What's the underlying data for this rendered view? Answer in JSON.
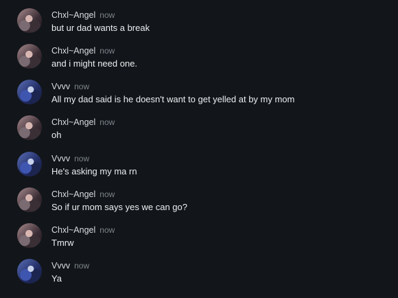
{
  "messages": [
    {
      "author": "Chxl~Angel",
      "time": "now",
      "text": "but ur dad wants a break",
      "avatar_icon": "angel-avatar"
    },
    {
      "author": "Chxl~Angel",
      "time": "now",
      "text": "and i might need one.",
      "avatar_icon": "angel-avatar"
    },
    {
      "author": "Vvvv",
      "time": "now",
      "text": "All my dad said is he doesn't want to get yelled at by my mom",
      "avatar_icon": "vvvv-avatar"
    },
    {
      "author": "Chxl~Angel",
      "time": "now",
      "text": "oh",
      "avatar_icon": "angel-avatar"
    },
    {
      "author": "Vvvv",
      "time": "now",
      "text": "He's asking my ma rn",
      "avatar_icon": "vvvv-avatar"
    },
    {
      "author": "Chxl~Angel",
      "time": "now",
      "text": "So if ur mom says yes we can go?",
      "avatar_icon": "angel-avatar"
    },
    {
      "author": "Chxl~Angel",
      "time": "now",
      "text": "Tmrw",
      "avatar_icon": "angel-avatar"
    },
    {
      "author": "Vvvv",
      "time": "now",
      "text": "Ya",
      "avatar_icon": "vvvv-avatar"
    }
  ],
  "colors": {
    "background": "#12161a",
    "name": "#d9dcdf",
    "timestamp": "#7d848b",
    "message_text": "#eceff1"
  }
}
